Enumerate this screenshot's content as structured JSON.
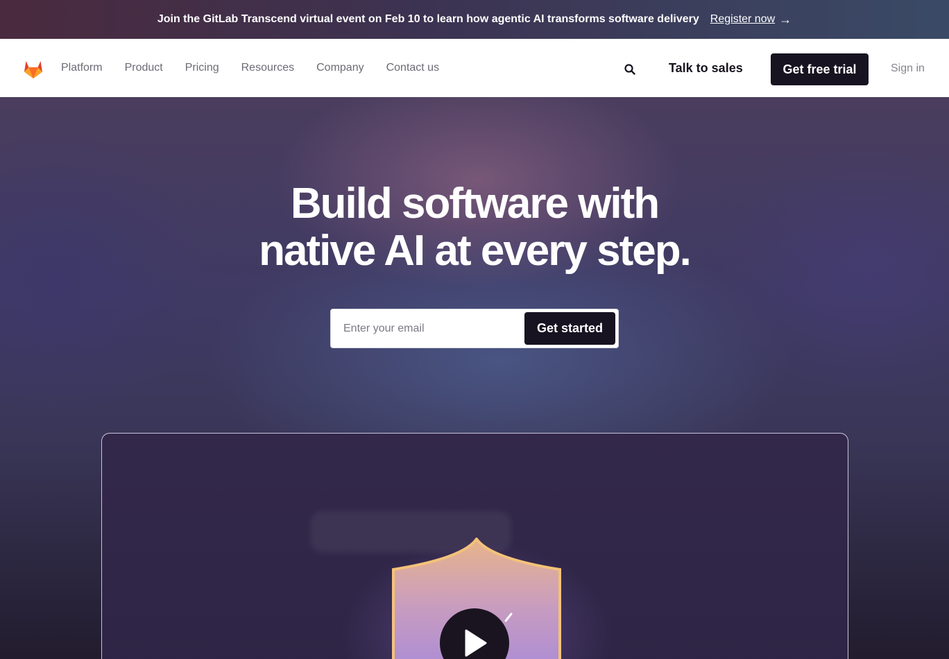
{
  "banner": {
    "message": "Join the GitLab Transcend virtual event on Feb 10 to learn how agentic AI transforms software delivery",
    "link_label": "Register now",
    "arrow": "→"
  },
  "nav": {
    "logo_icon": "gitlab-tanuki-icon",
    "links": [
      {
        "label": "Platform"
      },
      {
        "label": "Product"
      },
      {
        "label": "Pricing"
      },
      {
        "label": "Resources"
      },
      {
        "label": "Company"
      },
      {
        "label": "Contact us"
      }
    ],
    "search_icon": "search-icon",
    "talk_to_sales": "Talk to sales",
    "free_trial": "Get free trial",
    "sign_in": "Sign in"
  },
  "hero": {
    "headline_line1": "Build software with",
    "headline_line2": "native AI at every step.",
    "email_placeholder": "Enter your email",
    "cta_label": "Get started"
  },
  "video": {
    "play_icon": "play-icon",
    "illustration": "shield-icon"
  },
  "colors": {
    "dark_button": "#171321",
    "logo_orange": "#fc6d26",
    "logo_red": "#e24329",
    "logo_light": "#fca326"
  }
}
